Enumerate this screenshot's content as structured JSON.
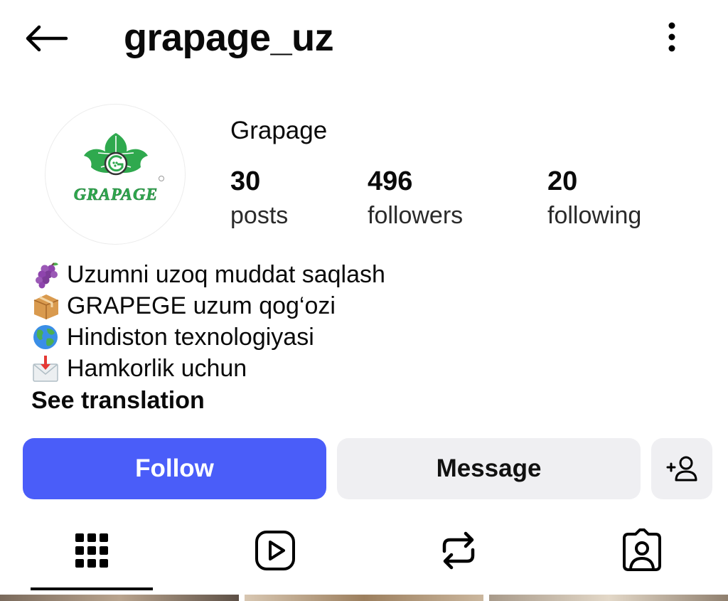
{
  "header": {
    "username": "grapage_uz",
    "back_icon": "arrow-left-icon",
    "more_icon": "more-vertical-icon"
  },
  "profile": {
    "display_name": "Grapage",
    "avatar_logo_text": "GRAPAGE",
    "stats": {
      "posts": {
        "value": "30",
        "label": "posts"
      },
      "followers": {
        "value": "496",
        "label": "followers"
      },
      "following": {
        "value": "20",
        "label": "following"
      }
    }
  },
  "bio": {
    "lines": [
      {
        "emoji": "grapes-emoji",
        "text": "Uzumni uzoq muddat saqlash"
      },
      {
        "emoji": "package-emoji",
        "text": "GRAPEGE uzum qog‘ozi"
      },
      {
        "emoji": "globe-emoji",
        "text": "Hindiston texnologiyasi"
      },
      {
        "emoji": "envelope-arrow-emoji",
        "text": "Hamkorlik uchun"
      }
    ],
    "see_translation": "See translation"
  },
  "actions": {
    "follow_label": "Follow",
    "message_label": "Message",
    "add_user_icon": "add-user-icon"
  },
  "tabs": [
    {
      "name": "grid",
      "icon": "grid-icon",
      "active": true
    },
    {
      "name": "reels",
      "icon": "reels-icon",
      "active": false
    },
    {
      "name": "reposts",
      "icon": "repost-icon",
      "active": false
    },
    {
      "name": "tagged",
      "icon": "tagged-icon",
      "active": false
    }
  ],
  "colors": {
    "follow_button": "#4a5df9",
    "secondary_button": "#efeff2",
    "logo_green": "#2fa94e",
    "text": "#0a0a0a"
  }
}
